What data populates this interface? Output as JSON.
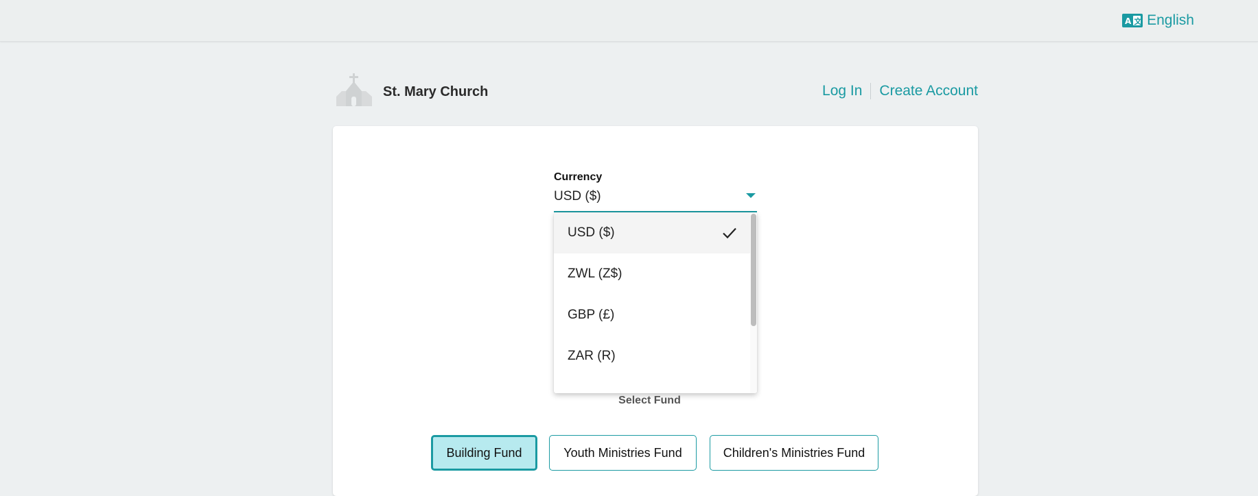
{
  "topbar": {
    "language_label": "English",
    "language_icon": "translate-icon"
  },
  "header": {
    "church_name": "St. Mary Church",
    "logo_icon": "church-icon",
    "login_label": "Log In",
    "create_account_label": "Create Account"
  },
  "currency": {
    "label": "Currency",
    "selected": "USD ($)",
    "options": [
      "USD ($)",
      "ZWL (Z$)",
      "GBP (£)",
      "ZAR (R)"
    ]
  },
  "funds": {
    "title": "Select Fund",
    "items": [
      "Building Fund",
      "Youth Ministries Fund",
      "Children's Ministries Fund"
    ],
    "active_index": 0
  },
  "colors": {
    "accent": "#1a9aa2",
    "active_fund_bg": "#b7eaef",
    "page_bg": "#edf0f1"
  }
}
